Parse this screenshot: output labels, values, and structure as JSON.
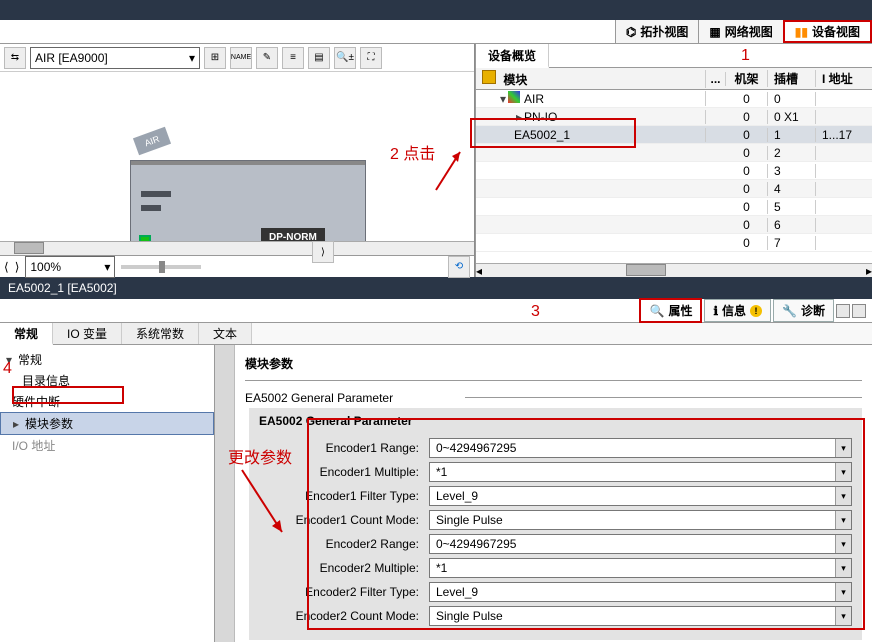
{
  "view_tabs": {
    "topology": "拓扑视图",
    "network": "网络视图",
    "device": "设备视图"
  },
  "device_dropdown": "AIR [EA9000]",
  "zoom": "100%",
  "overview_tab": "设备概览",
  "table_headers": {
    "module": "模块",
    "rack": "机架",
    "slot": "插槽",
    "addr": "I 地址"
  },
  "rows": [
    {
      "name": "AIR",
      "rack": "0",
      "slot": "0",
      "addr": "",
      "indent": 1,
      "toggle": "▾",
      "icon": true
    },
    {
      "name": "PN-IO",
      "rack": "0",
      "slot": "0 X1",
      "addr": "",
      "indent": 2,
      "toggle": "▸"
    },
    {
      "name": "EA5002_1",
      "rack": "0",
      "slot": "1",
      "addr": "1...17",
      "indent": 2,
      "selected": true
    },
    {
      "name": "",
      "rack": "0",
      "slot": "2",
      "addr": ""
    },
    {
      "name": "",
      "rack": "0",
      "slot": "3",
      "addr": ""
    },
    {
      "name": "",
      "rack": "0",
      "slot": "4",
      "addr": ""
    },
    {
      "name": "",
      "rack": "0",
      "slot": "5",
      "addr": ""
    },
    {
      "name": "",
      "rack": "0",
      "slot": "6",
      "addr": ""
    },
    {
      "name": "",
      "rack": "0",
      "slot": "7",
      "addr": ""
    }
  ],
  "canvas": {
    "air": "AIR",
    "dpnorm": "DP-NORM"
  },
  "lower_title": "EA5002_1 [EA5002]",
  "lower_tabs": {
    "properties": "属性",
    "info": "信息",
    "diag": "诊断"
  },
  "prop_tabs": {
    "general": "常规",
    "io": "IO 变量",
    "sysconst": "系统常数",
    "text": "文本"
  },
  "nav": {
    "general": "常规",
    "catalog": "目录信息",
    "hw_int": "硬件中断",
    "mod_param": "模块参数",
    "io_addr": "I/O 地址"
  },
  "section": {
    "title": "模块参数",
    "sub1": "EA5002 General Parameter",
    "sub2": "EA5002 General Parameter"
  },
  "params": [
    {
      "label": "Encoder1 Range:",
      "value": "0~4294967295"
    },
    {
      "label": "Encoder1 Multiple:",
      "value": "*1"
    },
    {
      "label": "Encoder1 Filter Type:",
      "value": "Level_9"
    },
    {
      "label": "Encoder1 Count Mode:",
      "value": "Single Pulse"
    },
    {
      "label": "Encoder2 Range:",
      "value": "0~4294967295"
    },
    {
      "label": "Encoder2 Multiple:",
      "value": "*1"
    },
    {
      "label": "Encoder2 Filter Type:",
      "value": "Level_9"
    },
    {
      "label": "Encoder2 Count Mode:",
      "value": "Single Pulse"
    }
  ],
  "annot": {
    "n1": "1",
    "n2": "2 点击",
    "n3": "3",
    "n4": "4",
    "change": "更改参数"
  }
}
